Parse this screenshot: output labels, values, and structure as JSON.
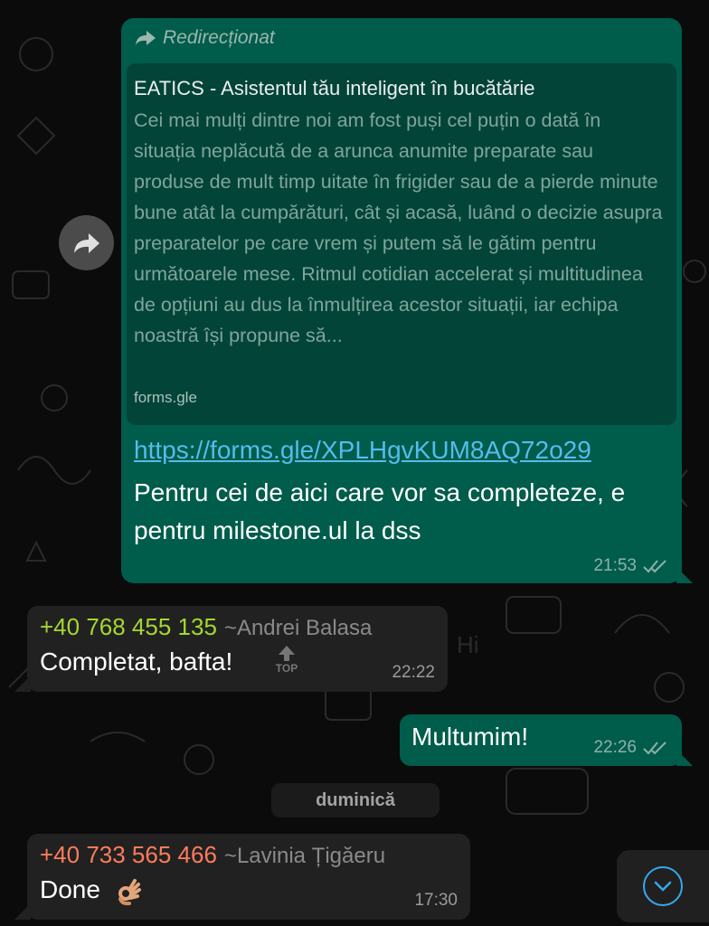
{
  "forwarded_message": {
    "forwarded_label": "Redirecționat",
    "preview": {
      "title": "EATICS - Asistentul tău inteligent în bucătărie",
      "description": "Cei mai mulți dintre noi am fost puși cel puțin o dată în situația neplăcută de a arunca anumite preparate sau produse de mult timp uitate în frigider sau de a pierde minute bune atât la cumpărături, cât și acasă, luând o decizie asupra preparatelor pe care vrem și putem să le gătim pentru următoarele mese. Ritmul cotidian accelerat și multitudinea de opțiuni au dus la înmulțirea acestor situații, iar echipa noastră își propune să...",
      "domain": "forms.gle"
    },
    "link": "https://forms.gle/XPLHgvKUM8AQ72o29",
    "text": "Pentru cei de aici care vor sa completeze, e pentru milestone.ul la dss",
    "time": "21:53"
  },
  "message_andrei": {
    "phone": "+40 768 455 135",
    "alias": "~Andrei Balasa",
    "text": "Completat, bafta!",
    "time": "22:22",
    "top_hint": "TOP"
  },
  "message_out_thanks": {
    "text": "Multumim!",
    "time": "22:26"
  },
  "day_separator": "duminică",
  "message_lavinia": {
    "phone": "+40 733 565 466",
    "alias": "~Lavinia Țigăeru",
    "text": "Done",
    "emoji": "ok-hand-emoji",
    "time": "17:30"
  },
  "icons": {
    "forward": "forward-arrow-icon",
    "read_receipt": "double-check-icon",
    "scroll_down": "chevron-down-icon"
  },
  "colors": {
    "outgoing_bubble": "#005c4b",
    "incoming_bubble": "#212121",
    "link": "#53bdeb",
    "sender_green": "#a5d631",
    "sender_red": "#ff7c5c",
    "accent_blue": "#36a8ee"
  }
}
